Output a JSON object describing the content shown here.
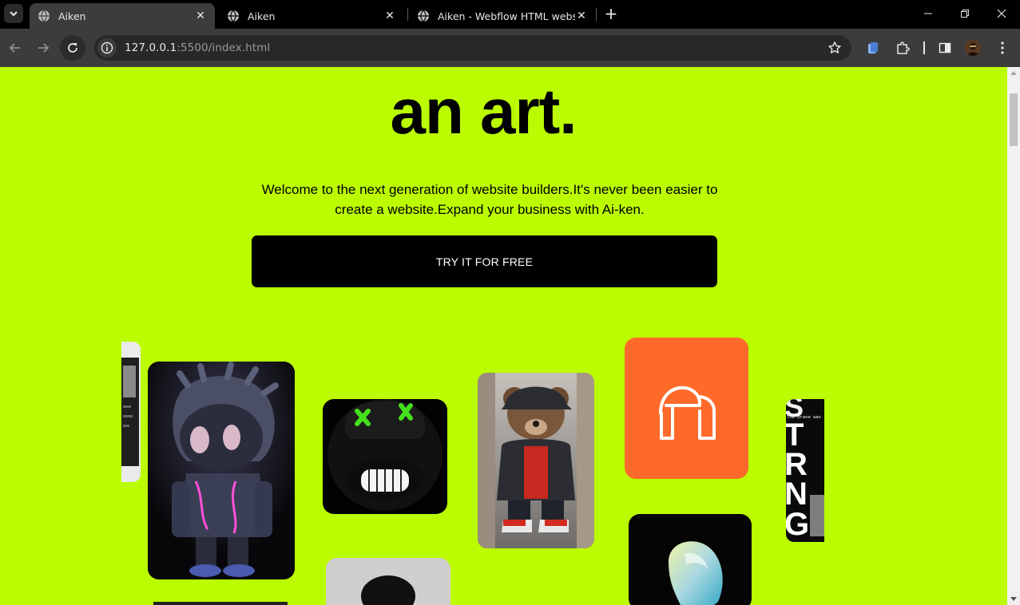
{
  "browser": {
    "tabs": [
      {
        "title": "Aiken",
        "active": true
      },
      {
        "title": "Aiken",
        "active": false
      },
      {
        "title": "Aiken - Webflow HTML website",
        "active": false
      }
    ],
    "url_host": "127.0.0.1",
    "url_rest": ":5500/index.html",
    "icons": [
      "tab-search-icon",
      "globe-icon",
      "close-icon",
      "plus-icon",
      "minimize-icon",
      "restore-icon",
      "back-arrow-icon",
      "forward-arrow-icon",
      "reload-icon",
      "site-info-icon",
      "bookmark-star-icon",
      "extension-icon",
      "side-panel-icon",
      "profile-avatar",
      "kebab-menu-icon"
    ]
  },
  "page": {
    "title": "an art.",
    "subtitle": "Welcome to the next generation of website builders.It's never been easier to create a website.Expand your business with Ai-ken.",
    "cta_label": "TRY IT FOR FREE",
    "gallery_poster_text": "The brave was",
    "gallery_poster_letters": "STRNG"
  },
  "colors": {
    "page_bg": "#bbfc02",
    "button_bg": "#000000",
    "orange_card": "#ff6a2b"
  }
}
